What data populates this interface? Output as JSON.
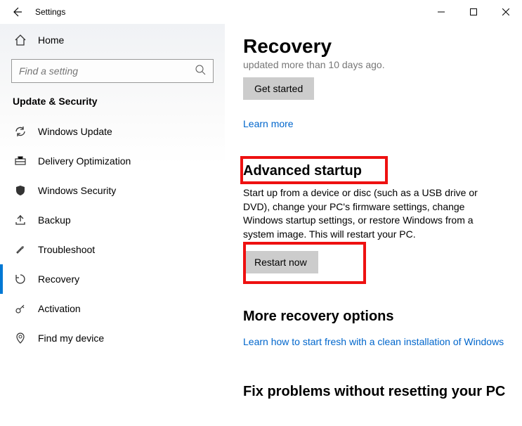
{
  "titlebar": {
    "title": "Settings"
  },
  "sidebar": {
    "home": "Home",
    "search_placeholder": "Find a setting",
    "category": "Update & Security",
    "items": [
      {
        "label": "Windows Update"
      },
      {
        "label": "Delivery Optimization"
      },
      {
        "label": "Windows Security"
      },
      {
        "label": "Backup"
      },
      {
        "label": "Troubleshoot"
      },
      {
        "label": "Recovery"
      },
      {
        "label": "Activation"
      },
      {
        "label": "Find my device"
      }
    ]
  },
  "main": {
    "page_title": "Recovery",
    "truncated_line": "updated more than 10 days ago.",
    "get_started": "Get started",
    "learn_more": "Learn more",
    "advanced_heading": "Advanced startup",
    "advanced_body": "Start up from a device or disc (such as a USB drive or DVD), change your PC's firmware settings, change Windows startup settings, or restore Windows from a system image. This will restart your PC.",
    "restart_now": "Restart now",
    "more_options_heading": "More recovery options",
    "more_options_link": "Learn how to start fresh with a clean installation of Windows",
    "fix_heading": "Fix problems without resetting your PC"
  }
}
